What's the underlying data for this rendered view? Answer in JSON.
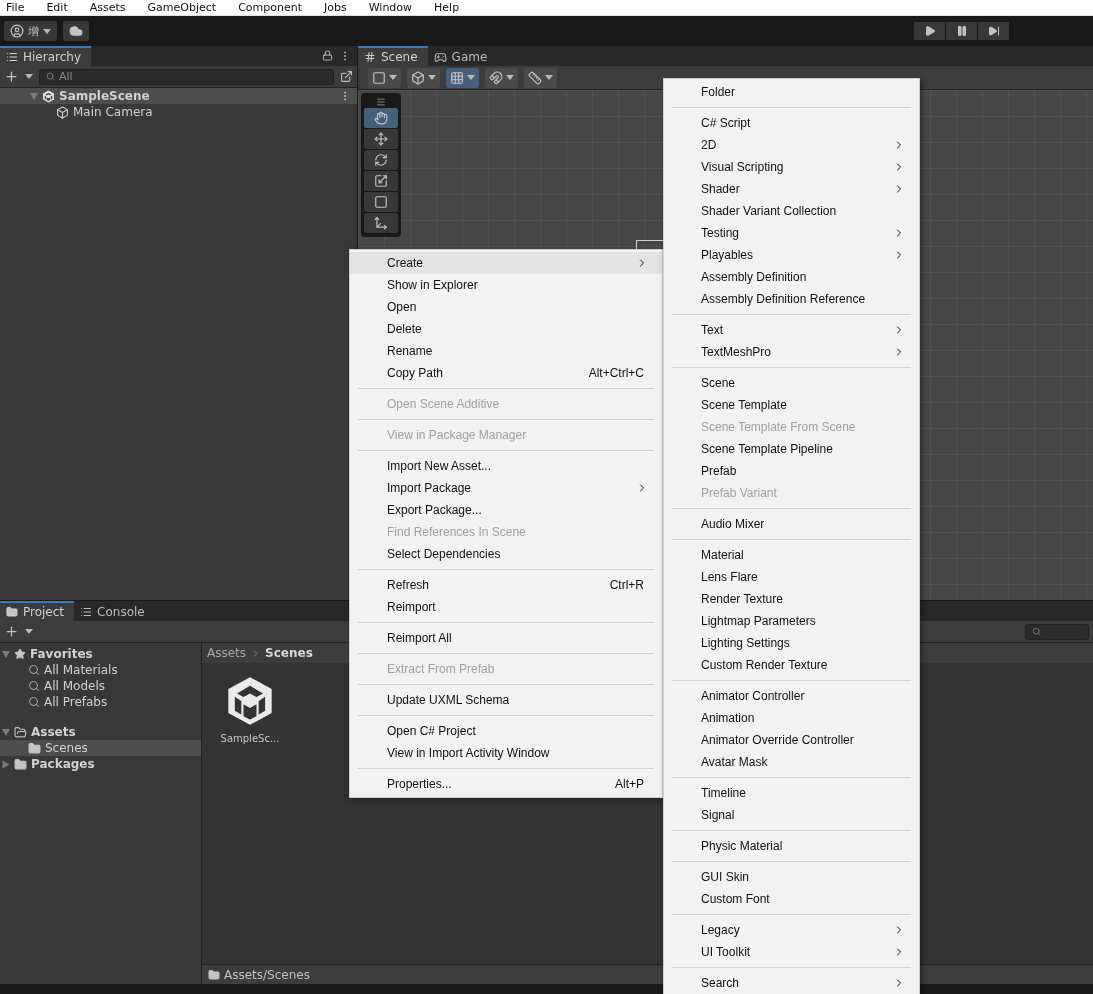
{
  "menu_bar": [
    "File",
    "Edit",
    "Assets",
    "GameObject",
    "Component",
    "Jobs",
    "Window",
    "Help"
  ],
  "toolbar": {
    "account": "增"
  },
  "hierarchy": {
    "tab": "Hierarchy",
    "search": {
      "placeholder": "All"
    },
    "scene": {
      "label": "SampleScene",
      "expanded": true,
      "children": [
        {
          "label": "Main Camera"
        }
      ]
    }
  },
  "scene_view": {
    "tabs": [
      {
        "label": "Scene",
        "kind": "scene",
        "selected": true
      },
      {
        "label": "Game",
        "kind": "game",
        "selected": false
      }
    ],
    "tools": [
      {
        "kind": "hand",
        "selected": true
      },
      {
        "kind": "move",
        "selected": false
      },
      {
        "kind": "rotate",
        "selected": false
      },
      {
        "kind": "scale",
        "selected": false
      },
      {
        "kind": "rect",
        "selected": false
      },
      {
        "kind": "transform",
        "selected": false
      }
    ]
  },
  "project": {
    "tabs": [
      {
        "label": "Project",
        "kind": "project",
        "selected": true
      },
      {
        "label": "Console",
        "kind": "console",
        "selected": false
      }
    ],
    "tree": [
      {
        "label": "Favorites",
        "kind": "favorites",
        "expanded": true,
        "selected": false,
        "children": [
          {
            "label": "All Materials",
            "kind": "search",
            "selected": false
          },
          {
            "label": "All Models",
            "kind": "search",
            "selected": false
          },
          {
            "label": "All Prefabs",
            "kind": "search",
            "selected": false
          }
        ]
      },
      {
        "label": "Assets",
        "kind": "folder",
        "expanded": true,
        "selected": false,
        "children": [
          {
            "label": "Scenes",
            "kind": "folder",
            "selected": true
          }
        ]
      },
      {
        "label": "Packages",
        "kind": "folder",
        "expanded": false,
        "selected": false
      }
    ],
    "breadcrumb": [
      "Assets",
      "Scenes"
    ],
    "assets": [
      {
        "label": "SampleSc..."
      }
    ],
    "path": "Assets/Scenes"
  },
  "context_menu": {
    "items": [
      {
        "kind": "item",
        "label": "Create",
        "submenu": true,
        "selected": true
      },
      {
        "kind": "item",
        "label": "Show in Explorer"
      },
      {
        "kind": "item",
        "label": "Open"
      },
      {
        "kind": "item",
        "label": "Delete"
      },
      {
        "kind": "item",
        "label": "Rename"
      },
      {
        "kind": "item",
        "label": "Copy Path",
        "shortcut": "Alt+Ctrl+C"
      },
      {
        "kind": "separator"
      },
      {
        "kind": "item",
        "label": "Open Scene Additive",
        "disabled": true
      },
      {
        "kind": "separator"
      },
      {
        "kind": "item",
        "label": "View in Package Manager",
        "disabled": true
      },
      {
        "kind": "separator"
      },
      {
        "kind": "item",
        "label": "Import New Asset..."
      },
      {
        "kind": "item",
        "label": "Import Package",
        "submenu": true
      },
      {
        "kind": "item",
        "label": "Export Package..."
      },
      {
        "kind": "item",
        "label": "Find References In Scene",
        "disabled": true
      },
      {
        "kind": "item",
        "label": "Select Dependencies"
      },
      {
        "kind": "separator"
      },
      {
        "kind": "item",
        "label": "Refresh",
        "shortcut": "Ctrl+R"
      },
      {
        "kind": "item",
        "label": "Reimport"
      },
      {
        "kind": "separator"
      },
      {
        "kind": "item",
        "label": "Reimport All"
      },
      {
        "kind": "separator"
      },
      {
        "kind": "item",
        "label": "Extract From Prefab",
        "disabled": true
      },
      {
        "kind": "separator"
      },
      {
        "kind": "item",
        "label": "Update UXML Schema"
      },
      {
        "kind": "separator"
      },
      {
        "kind": "item",
        "label": "Open C# Project"
      },
      {
        "kind": "item",
        "label": "View in Import Activity Window"
      },
      {
        "kind": "separator"
      },
      {
        "kind": "item",
        "label": "Properties...",
        "shortcut": "Alt+P"
      }
    ]
  },
  "create_submenu": {
    "items": [
      {
        "kind": "item",
        "label": "Folder"
      },
      {
        "kind": "separator"
      },
      {
        "kind": "item",
        "label": "C# Script"
      },
      {
        "kind": "item",
        "label": "2D",
        "submenu": true
      },
      {
        "kind": "item",
        "label": "Visual Scripting",
        "submenu": true
      },
      {
        "kind": "item",
        "label": "Shader",
        "submenu": true
      },
      {
        "kind": "item",
        "label": "Shader Variant Collection"
      },
      {
        "kind": "item",
        "label": "Testing",
        "submenu": true
      },
      {
        "kind": "item",
        "label": "Playables",
        "submenu": true
      },
      {
        "kind": "item",
        "label": "Assembly Definition"
      },
      {
        "kind": "item",
        "label": "Assembly Definition Reference"
      },
      {
        "kind": "separator"
      },
      {
        "kind": "item",
        "label": "Text",
        "submenu": true
      },
      {
        "kind": "item",
        "label": "TextMeshPro",
        "submenu": true
      },
      {
        "kind": "separator"
      },
      {
        "kind": "item",
        "label": "Scene"
      },
      {
        "kind": "item",
        "label": "Scene Template"
      },
      {
        "kind": "item",
        "label": "Scene Template From Scene",
        "disabled": true
      },
      {
        "kind": "item",
        "label": "Scene Template Pipeline"
      },
      {
        "kind": "item",
        "label": "Prefab"
      },
      {
        "kind": "item",
        "label": "Prefab Variant",
        "disabled": true
      },
      {
        "kind": "separator"
      },
      {
        "kind": "item",
        "label": "Audio Mixer"
      },
      {
        "kind": "separator"
      },
      {
        "kind": "item",
        "label": "Material"
      },
      {
        "kind": "item",
        "label": "Lens Flare"
      },
      {
        "kind": "item",
        "label": "Render Texture"
      },
      {
        "kind": "item",
        "label": "Lightmap Parameters"
      },
      {
        "kind": "item",
        "label": "Lighting Settings"
      },
      {
        "kind": "item",
        "label": "Custom Render Texture"
      },
      {
        "kind": "separator"
      },
      {
        "kind": "item",
        "label": "Animator Controller"
      },
      {
        "kind": "item",
        "label": "Animation"
      },
      {
        "kind": "item",
        "label": "Animator Override Controller"
      },
      {
        "kind": "item",
        "label": "Avatar Mask"
      },
      {
        "kind": "separator"
      },
      {
        "kind": "item",
        "label": "Timeline"
      },
      {
        "kind": "item",
        "label": "Signal"
      },
      {
        "kind": "separator"
      },
      {
        "kind": "item",
        "label": "Physic Material"
      },
      {
        "kind": "separator"
      },
      {
        "kind": "item",
        "label": "GUI Skin"
      },
      {
        "kind": "item",
        "label": "Custom Font"
      },
      {
        "kind": "separator"
      },
      {
        "kind": "item",
        "label": "Legacy",
        "submenu": true
      },
      {
        "kind": "item",
        "label": "UI Toolkit",
        "submenu": true
      },
      {
        "kind": "separator"
      },
      {
        "kind": "item",
        "label": "Search",
        "submenu": true
      }
    ]
  }
}
